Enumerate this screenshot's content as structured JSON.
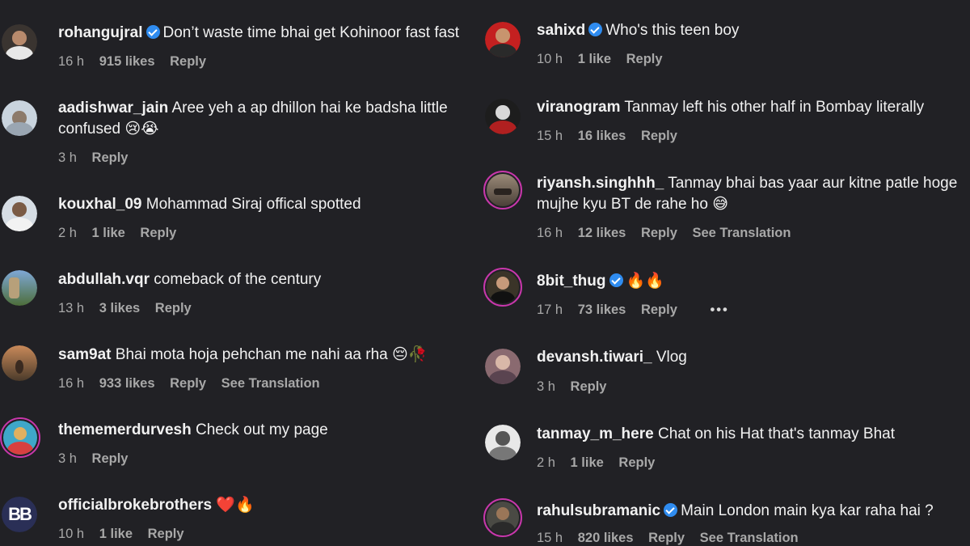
{
  "left_comments": [
    {
      "username": "rohangujral",
      "verified": true,
      "text": "Don’t waste time bhai get Kohinoor fast fast",
      "time": "16 h",
      "likes": "915 likes",
      "reply": "Reply",
      "translation": ""
    },
    {
      "username": "aadishwar_jain",
      "verified": false,
      "text": "Aree yeh a ap dhillon hai ke badsha little confused 😢😭",
      "time": "3 h",
      "likes": "",
      "reply": "Reply",
      "translation": ""
    },
    {
      "username": "kouxhal_09",
      "verified": false,
      "text": "Mohammad Siraj offical spotted",
      "time": "2 h",
      "likes": "1 like",
      "reply": "Reply",
      "translation": ""
    },
    {
      "username": "abdullah.vqr",
      "verified": false,
      "text": "comeback of the century",
      "time": "13 h",
      "likes": "3 likes",
      "reply": "Reply",
      "translation": ""
    },
    {
      "username": "sam9at",
      "verified": false,
      "text": "Bhai mota hoja pehchan me nahi aa rha 😔🥀",
      "time": "16 h",
      "likes": "933 likes",
      "reply": "Reply",
      "translation": "See Translation"
    },
    {
      "username": "thememerdurvesh",
      "verified": false,
      "text": "Check out my page",
      "time": "3 h",
      "likes": "",
      "reply": "Reply",
      "translation": ""
    },
    {
      "username": "officialbrokebrothers",
      "verified": false,
      "text": "❤️🔥",
      "time": "10 h",
      "likes": "1 like",
      "reply": "Reply",
      "translation": "",
      "avatar_text": "BB"
    }
  ],
  "right_comments": [
    {
      "username": "sahixd",
      "verified": true,
      "text": "Who's this teen boy",
      "time": "10 h",
      "likes": "1 like",
      "reply": "Reply",
      "translation": ""
    },
    {
      "username": "viranogram",
      "verified": false,
      "text": "Tanmay left his other half in Bombay literally",
      "time": "15 h",
      "likes": "16 likes",
      "reply": "Reply",
      "translation": ""
    },
    {
      "username": "riyansh.singhhh_",
      "verified": false,
      "text": "Tanmay bhai bas yaar aur kitne patle hoge mujhe kyu BT de rahe ho 😅",
      "time": "16 h",
      "likes": "12 likes",
      "reply": "Reply",
      "translation": "See Translation"
    },
    {
      "username": "8bit_thug",
      "verified": true,
      "text": "🔥🔥",
      "time": "17 h",
      "likes": "73 likes",
      "reply": "Reply",
      "translation": "",
      "more": "•••"
    },
    {
      "username": "devansh.tiwari_",
      "verified": false,
      "text": "Vlog",
      "time": "3 h",
      "likes": "",
      "reply": "Reply",
      "translation": ""
    },
    {
      "username": "tanmay_m_here",
      "verified": false,
      "text": "Chat on his Hat that's tanmay Bhat",
      "time": "2 h",
      "likes": "1 like",
      "reply": "Reply",
      "translation": ""
    },
    {
      "username": "rahulsubramanic",
      "verified": true,
      "text": "Main London main kya kar raha hai ?",
      "time": "15 h",
      "likes": "820 likes",
      "reply": "Reply",
      "translation": "See Translation"
    }
  ],
  "colors": {
    "background": "#212125",
    "text": "#f1f1f1",
    "meta": "#a8a8a8",
    "verified": "#2f8cf0",
    "story_ring": "#c837ab"
  }
}
